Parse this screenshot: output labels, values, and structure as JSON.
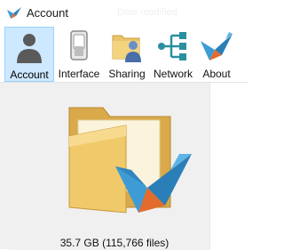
{
  "window": {
    "title": "Account",
    "ghost_title": "Date modified"
  },
  "toolbar": {
    "tabs": [
      {
        "id": "account",
        "label": "Account",
        "icon": "account-silhouette-icon",
        "active": true
      },
      {
        "id": "interface",
        "label": "Interface",
        "icon": "toggle-switch-icon",
        "active": false
      },
      {
        "id": "sharing",
        "label": "Sharing",
        "icon": "shared-folder-user-icon",
        "active": false
      },
      {
        "id": "network",
        "label": "Network",
        "icon": "network-tree-icon",
        "active": false
      },
      {
        "id": "about",
        "label": "About",
        "icon": "origami-bird-icon",
        "active": false
      }
    ]
  },
  "account": {
    "storage_summary": "35.7 GB (115,766 files)"
  },
  "colors": {
    "active_tab_bg": "#cde8ff",
    "active_tab_border": "#99d1ff",
    "folder": "#e9c46a",
    "network_teal": "#2a8fa0",
    "bird_blue": "#3d9bd6",
    "bird_orange": "#e36b2b"
  }
}
